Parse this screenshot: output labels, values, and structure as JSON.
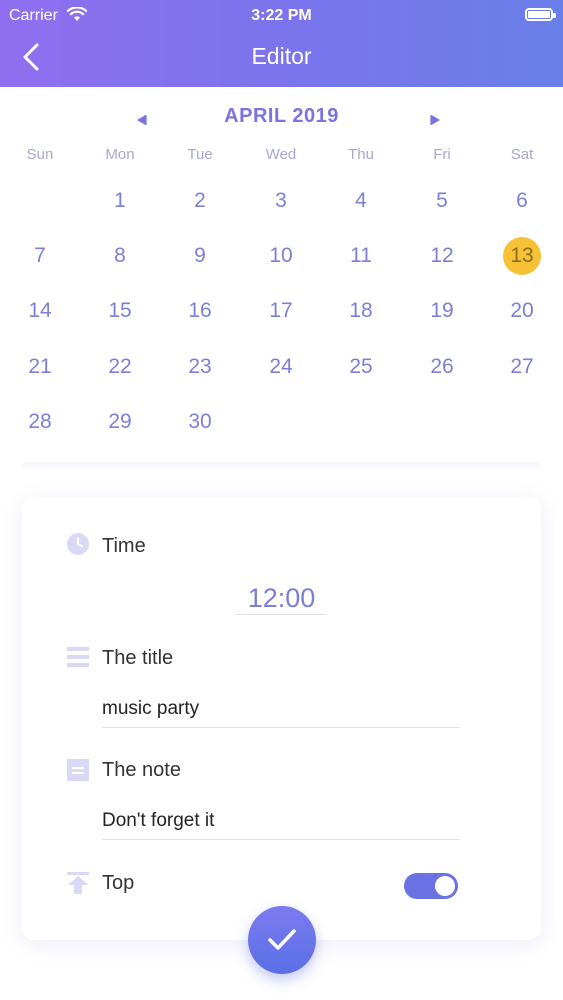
{
  "status_bar": {
    "carrier": "Carrier",
    "time": "3:22 PM"
  },
  "nav": {
    "title": "Editor"
  },
  "calendar": {
    "month_label": "APRIL 2019",
    "weekdays": [
      "Sun",
      "Mon",
      "Tue",
      "Wed",
      "Thu",
      "Fri",
      "Sat"
    ],
    "days": [
      "1",
      "2",
      "3",
      "4",
      "5",
      "6",
      "7",
      "8",
      "9",
      "10",
      "11",
      "12",
      "13",
      "14",
      "15",
      "16",
      "17",
      "18",
      "19",
      "20",
      "21",
      "22",
      "23",
      "24",
      "25",
      "26",
      "27",
      "28",
      "29",
      "30"
    ],
    "first_weekday_index": 1,
    "selected_day": "13"
  },
  "form": {
    "time_label": "Time",
    "time_value": "12:00",
    "title_label": "The title",
    "title_value": "music party",
    "note_label": "The note",
    "note_value": "Don't forget it",
    "top_label": "Top",
    "top_enabled": true
  },
  "colors": {
    "accent": "#7b7fd6",
    "header_gradient_start": "#8f6ff0",
    "header_gradient_end": "#6a7fe9",
    "selected_day": "#f6c135",
    "toggle_on": "#6b72e4"
  },
  "icons": {
    "back": "chevron-left-icon",
    "time": "clock-icon",
    "title": "list-icon",
    "note": "note-icon",
    "top": "pin-top-icon",
    "confirm": "checkmark-icon"
  }
}
